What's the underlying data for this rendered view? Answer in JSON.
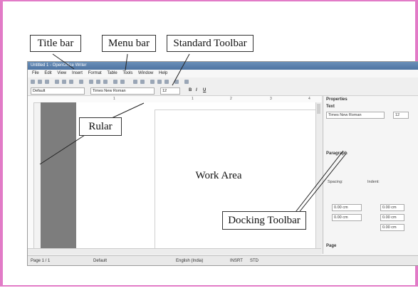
{
  "window": {
    "title": "Untitled 1 - OpenOffice Writer",
    "menu": [
      "File",
      "Edit",
      "View",
      "Insert",
      "Format",
      "Table",
      "Tools",
      "Window",
      "Help"
    ],
    "paragraph_style": "Default",
    "font_name": "Times New Roman",
    "font_size": "12",
    "format_buttons": [
      "B",
      "I",
      "U"
    ]
  },
  "sidebar": {
    "title": "Properties",
    "text_section": "Text",
    "font_name": "Times New Roman",
    "font_size": "12",
    "paragraph_section": "Paragraph",
    "spacing_label": "Spacing:",
    "indent_label": "Indent:",
    "fields": [
      "0.00 cm",
      "0.00 cm",
      "0.00 cm",
      "0.00 cm",
      "0.00 cm"
    ],
    "page_section": "Page"
  },
  "statusbar": {
    "page": "Page 1 / 1",
    "style": "Default",
    "language": "English (India)",
    "insert": "INSRT",
    "std": "STD"
  },
  "callouts": {
    "title_bar": "Title bar",
    "menu_bar": "Menu bar",
    "standard_toolbar": "Standard Toolbar",
    "ruler": "Rular",
    "work_area": "Work Area",
    "docking_toolbar": "Docking Toolbar"
  }
}
